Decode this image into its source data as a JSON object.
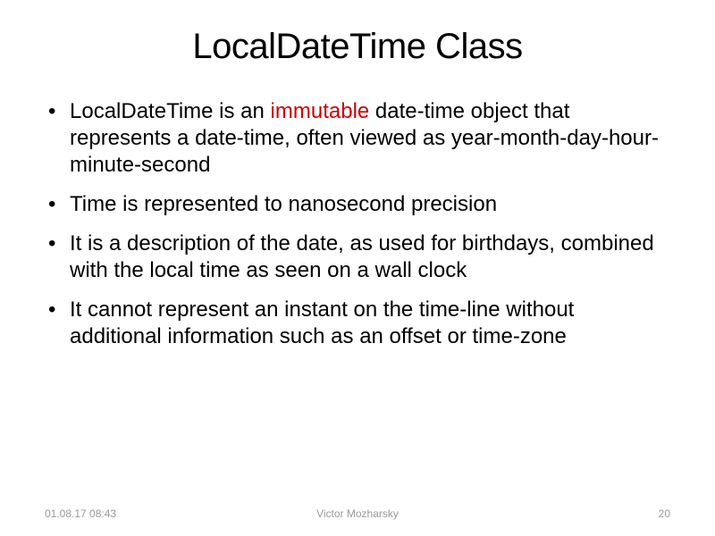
{
  "slide": {
    "title": "LocalDateTime Class",
    "bullets": [
      {
        "prefix": "LocalDateTime is an ",
        "highlight": "immutable",
        "suffix": " date-time object that represents a date-time, often viewed as year-month-day-hour-minute-second"
      },
      {
        "text": "Time is represented to nanosecond precision"
      },
      {
        "text": "It is a description of the date, as used for birthdays, combined with the local time as seen on a wall clock"
      },
      {
        "text": "It cannot represent an instant on the time-line without additional information such as an offset or time-zone"
      }
    ]
  },
  "footer": {
    "date": "01.08.17 08:43",
    "author": "Victor Mozharsky",
    "page": "20"
  },
  "colors": {
    "highlight": "#cc0000",
    "footer": "#9a9a9a"
  }
}
